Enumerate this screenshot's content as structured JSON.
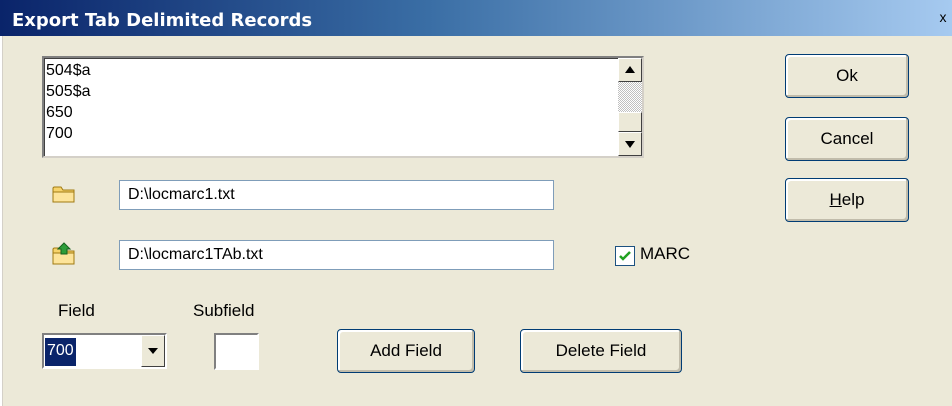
{
  "window": {
    "title": "Export Tab Delimited Records",
    "close_glyph": "x"
  },
  "field_list": {
    "items": [
      "504$a",
      "505$a",
      "650",
      "700"
    ]
  },
  "buttons": {
    "ok": "Ok",
    "cancel": "Cancel",
    "help_underlined": "H",
    "help_rest": "elp",
    "add_field": "Add Field",
    "delete_field": "Delete Field"
  },
  "paths": {
    "input_file": "D:\\locmarc1.txt",
    "output_file": "D:\\locmarc1TAb.txt"
  },
  "options": {
    "marc_label": "MARC",
    "marc_checked": true
  },
  "field_selector": {
    "field_label": "Field",
    "field_value": "700",
    "subfield_label": "Subfield",
    "subfield_value": ""
  },
  "icons": {
    "input_file": "folder-icon",
    "output_file": "export-folder-icon"
  }
}
